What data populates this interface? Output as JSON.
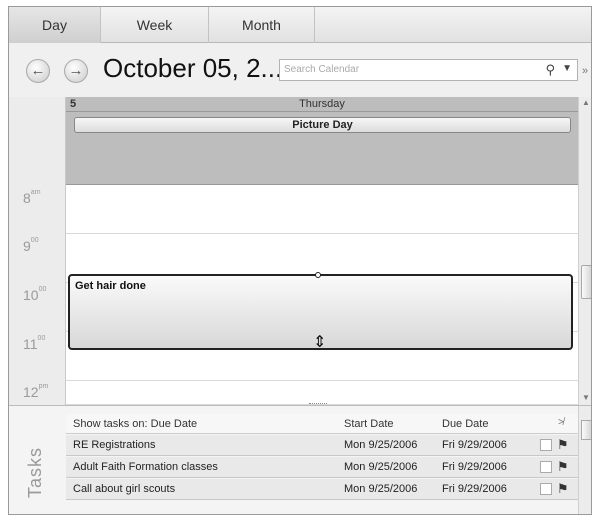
{
  "tabs": [
    {
      "label": "Day"
    },
    {
      "label": "Week"
    },
    {
      "label": "Month"
    }
  ],
  "nav": {
    "title": "October 05, 2...",
    "search_placeholder": "Search Calendar",
    "back_icon": "back-arrow",
    "forward_icon": "forward-arrow"
  },
  "day_header": {
    "day_number": "5",
    "day_name": "Thursday",
    "all_day_event": "Picture Day"
  },
  "hours": [
    {
      "label": "8",
      "suffix": "am"
    },
    {
      "label": "9",
      "suffix": "00"
    },
    {
      "label": "10",
      "suffix": "00"
    },
    {
      "label": "11",
      "suffix": "00"
    },
    {
      "label": "12",
      "suffix": "pm"
    }
  ],
  "appointment": {
    "subject": "Get hair done"
  },
  "tasks": {
    "side_label": "Tasks",
    "header": {
      "show_label": "Show tasks on: Due Date",
      "start_col": "Start Date",
      "due_col": "Due Date"
    },
    "rows": [
      {
        "name": "RE  Registrations",
        "start": "Mon 9/25/2006",
        "due": "Fri 9/29/2006"
      },
      {
        "name": "Adult Faith Formation classes",
        "start": "Mon 9/25/2006",
        "due": "Fri 9/29/2006"
      },
      {
        "name": "Call about girl scouts",
        "start": "Mon 9/25/2006",
        "due": "Fri 9/29/2006"
      }
    ]
  }
}
